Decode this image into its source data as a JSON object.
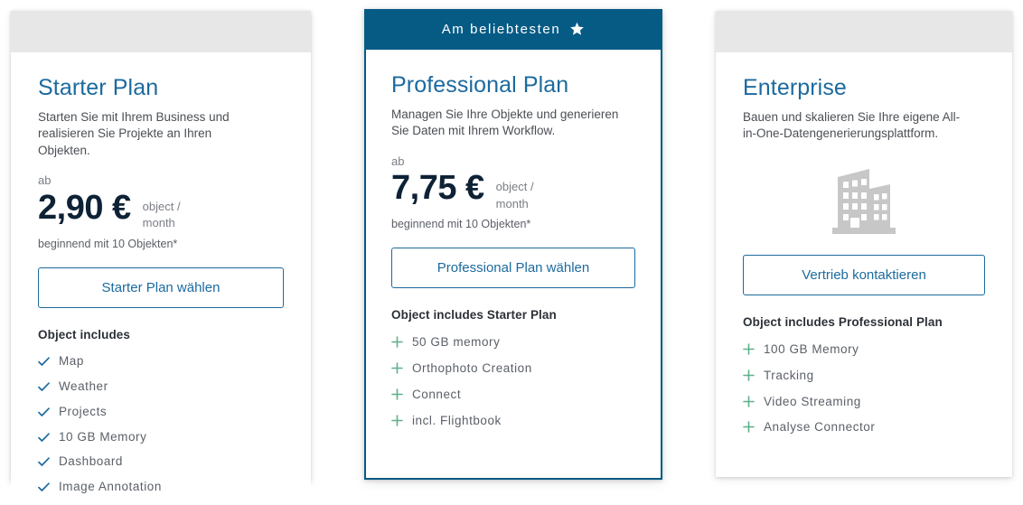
{
  "plans": [
    {
      "id": "starter",
      "featured": false,
      "badge": null,
      "title": "Starter Plan",
      "description": "Starten Sie mit Ihrem Business und realisieren Sie Projekte an Ihren Objekten.",
      "price_prefix": "ab",
      "price_amount": "2,90 €",
      "price_unit": "object / month",
      "price_note": "beginnend mit 10 Objekten*",
      "cta_label": "Starter Plan wählen",
      "features_heading": "Object includes",
      "feature_icon": "check-icon",
      "features": [
        "Map",
        "Weather",
        "Projects",
        "10 GB Memory",
        "Dashboard",
        "Image Annotation"
      ]
    },
    {
      "id": "professional",
      "featured": true,
      "badge": {
        "label": "Am beliebtesten",
        "icon": "star-icon"
      },
      "title": "Professional Plan",
      "description": "Managen Sie Ihre Objekte und generieren Sie Daten mit Ihrem Workflow.",
      "price_prefix": "ab",
      "price_amount": "7,75 €",
      "price_unit": "object / month",
      "price_note": "beginnend mit 10 Objekten*",
      "cta_label": "Professional Plan wählen",
      "features_heading": "Object includes Starter Plan",
      "feature_icon": "plus-icon",
      "features": [
        "50 GB memory",
        "Orthophoto Creation",
        "Connect",
        "incl. Flightbook"
      ]
    },
    {
      "id": "enterprise",
      "featured": false,
      "badge": null,
      "title": "Enterprise",
      "description": "Bauen und skalieren Sie Ihre eigene All-in-One-Datengenerierungsplattform.",
      "illustration": "office-building-icon",
      "cta_label": "Vertrieb kontaktieren",
      "features_heading": "Object includes Professional Plan",
      "feature_icon": "plus-icon",
      "features": [
        "100 GB Memory",
        "Tracking",
        "Video Streaming",
        "Analyse Connector"
      ]
    }
  ],
  "colors": {
    "brand_blue": "#065B85",
    "title_blue": "#1C6A9E",
    "price_navy": "#0E2236",
    "band_gray": "#E7E7E7",
    "plus_green": "#5FB08C",
    "check_blue": "#1C6A9E",
    "illustration_gray": "#C7C7C7",
    "page_background": "#FFFFFF"
  }
}
